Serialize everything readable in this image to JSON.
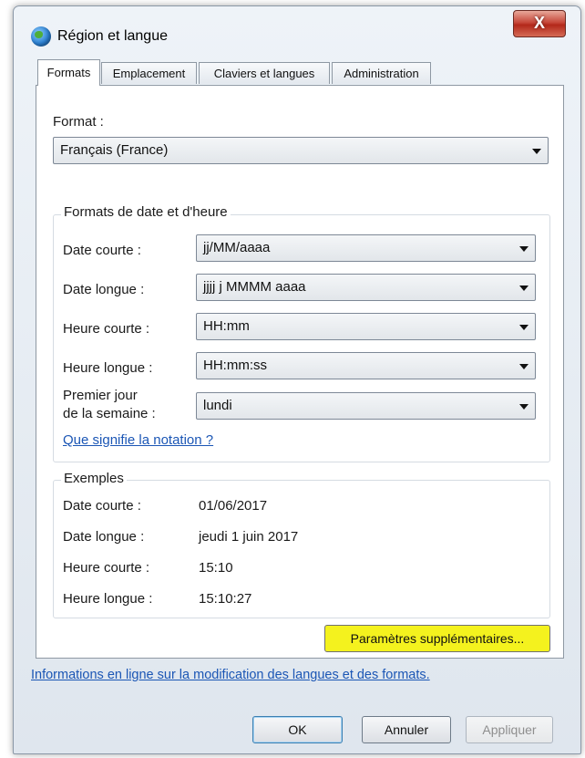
{
  "window": {
    "title": "Région et langue",
    "close_glyph": "X"
  },
  "tabs": [
    {
      "label": "Formats",
      "active": true
    },
    {
      "label": "Emplacement",
      "active": false
    },
    {
      "label": "Claviers et langues",
      "active": false
    },
    {
      "label": "Administration",
      "active": false
    }
  ],
  "format": {
    "label": "Format :",
    "value": "Français (France)"
  },
  "date_time_group": {
    "title": "Formats de date et d'heure",
    "rows": [
      {
        "label": "Date courte :",
        "value": "jj/MM/aaaa"
      },
      {
        "label": "Date longue :",
        "value": "jjjj j MMMM aaaa"
      },
      {
        "label": "Heure courte :",
        "value": "HH:mm"
      },
      {
        "label": "Heure longue :",
        "value": "HH:mm:ss"
      },
      {
        "label_line1": "Premier jour",
        "label_line2": "de la semaine :",
        "value": "lundi"
      }
    ],
    "notation_link": "Que signifie la notation ?"
  },
  "examples": {
    "title": "Exemples",
    "rows": [
      {
        "label": "Date courte :",
        "value": "01/06/2017"
      },
      {
        "label": "Date longue :",
        "value": "jeudi 1 juin 2017"
      },
      {
        "label": "Heure courte :",
        "value": "15:10"
      },
      {
        "label": "Heure longue :",
        "value": "15:10:27"
      }
    ]
  },
  "buttons": {
    "additional_settings": "Paramètres supplémentaires...",
    "ok": "OK",
    "cancel": "Annuler",
    "apply": "Appliquer"
  },
  "online_info_link": "Informations en ligne sur la modification des langues et des formats.",
  "icons": {
    "app": "globe-icon",
    "dropdown": "chevron-down-icon"
  },
  "colors": {
    "highlight": "#f4f21e",
    "link": "#1b56b5",
    "close": "#c7483a"
  }
}
